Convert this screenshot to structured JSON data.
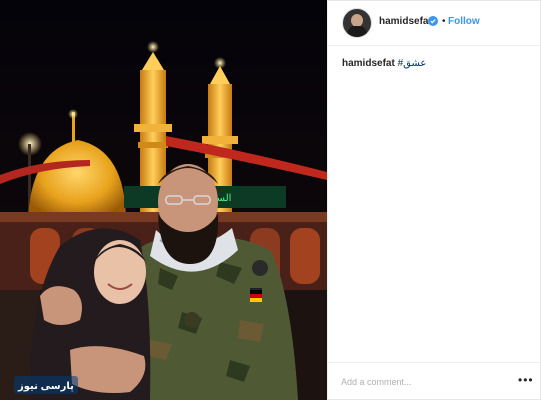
{
  "post": {
    "username": "hamidsefat",
    "follow_label": "Follow",
    "separator": "•",
    "caption_user": "hamidsefat",
    "caption_text": "#عشق",
    "comment_placeholder": "Add a comment...",
    "more_label": "•••",
    "photo_sign": "السلام علیك",
    "watermark_text": "پارسی نیوز"
  },
  "icons": {
    "verified": "verified-badge-icon",
    "more": "more-options-icon"
  },
  "colors": {
    "follow": "#3897f0",
    "verified": "#3897f0",
    "hashtag": "#003569"
  }
}
